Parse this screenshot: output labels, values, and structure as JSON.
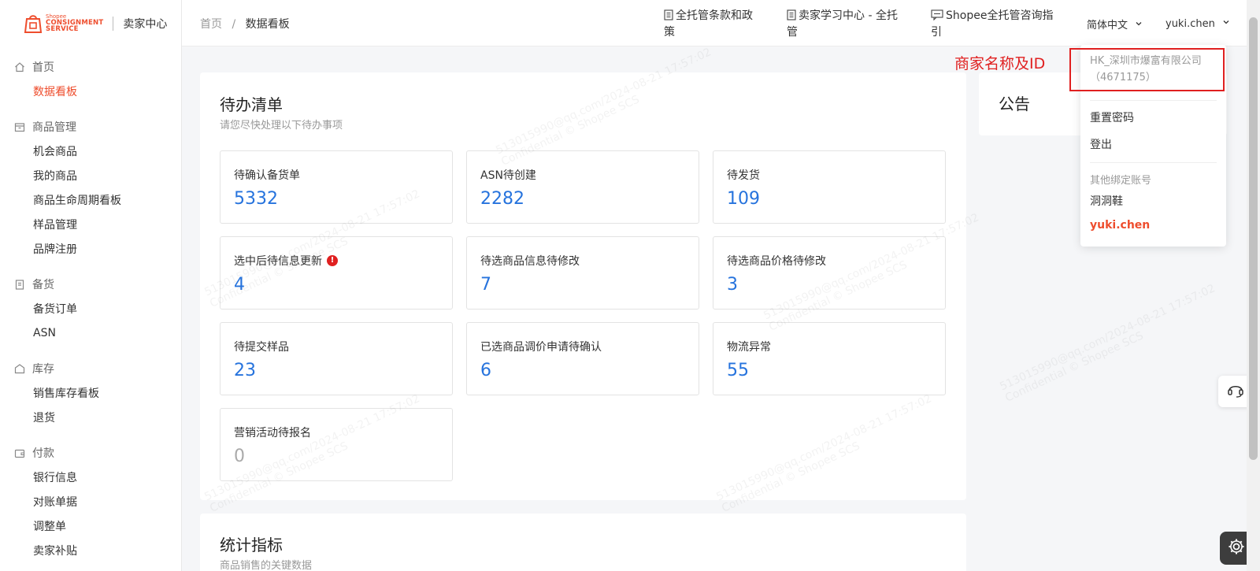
{
  "brand": {
    "logo_small": "Shopee",
    "logo_line1": "CONSIGNMENT",
    "logo_line2": "SERVICE",
    "portal_title": "卖家中心",
    "accent_color": "#ee4d2d"
  },
  "sidebar": {
    "groups": [
      {
        "title": "首页",
        "icon": "home-icon",
        "items": [
          "数据看板"
        ]
      },
      {
        "title": "商品管理",
        "icon": "box-icon",
        "items": [
          "机会商品",
          "我的商品",
          "商品生命周期看板",
          "样品管理",
          "品牌注册"
        ]
      },
      {
        "title": "备货",
        "icon": "clipboard-icon",
        "items": [
          "备货订单",
          "ASN"
        ]
      },
      {
        "title": "库存",
        "icon": "warehouse-icon",
        "items": [
          "销售库存看板",
          "退货"
        ]
      },
      {
        "title": "付款",
        "icon": "wallet-icon",
        "items": [
          "银行信息",
          "对账单据",
          "调整单",
          "卖家补贴"
        ]
      }
    ],
    "active_item": "数据看板"
  },
  "header": {
    "breadcrumb": [
      "首页",
      "数据看板"
    ],
    "breadcrumb_separator": "/",
    "links": [
      {
        "icon": "document-icon",
        "line1": "全托管条款和政",
        "line2": "策"
      },
      {
        "icon": "document-icon",
        "line1": "卖家学习中心 - 全托",
        "line2": "管"
      },
      {
        "icon": "chat-icon",
        "line1": "Shopee全托管咨询指",
        "line2": "引"
      }
    ],
    "language": "简体中文",
    "username": "yuki.chen"
  },
  "todo": {
    "title": "待办清单",
    "subtitle": "请您尽快处理以下待办事项",
    "tiles": [
      {
        "label": "待确认备货单",
        "value": "5332"
      },
      {
        "label": "ASN待创建",
        "value": "2282"
      },
      {
        "label": "待发货",
        "value": "109"
      },
      {
        "label": "选中后待信息更新",
        "value": "4",
        "alert": "!"
      },
      {
        "label": "待选商品信息待修改",
        "value": "7"
      },
      {
        "label": "待选商品价格待修改",
        "value": "3"
      },
      {
        "label": "待提交样品",
        "value": "23"
      },
      {
        "label": "已选商品调价申请待确认",
        "value": "6"
      },
      {
        "label": "物流异常",
        "value": "55"
      },
      {
        "label": "营销活动待报名",
        "value": "0"
      }
    ]
  },
  "stats": {
    "title": "统计指标",
    "subtitle": "商品销售的关键数据"
  },
  "announcement": {
    "title": "公告"
  },
  "account_menu": {
    "account_name": "HK_深圳市爆富有限公司",
    "account_id": "（4671175）",
    "reset_password": "重置密码",
    "logout": "登出",
    "linked_section": "其他绑定账号",
    "linked_accounts": [
      "洞洞鞋",
      "yuki.chen"
    ],
    "current_account": "yuki.chen"
  },
  "annotation": {
    "label": "商家名称及ID",
    "color": "#e02020"
  },
  "watermark": {
    "line1": "513015990@qq.com/2024-08-21 17:57:02",
    "line2": "Confidential © Shopee SCS"
  }
}
